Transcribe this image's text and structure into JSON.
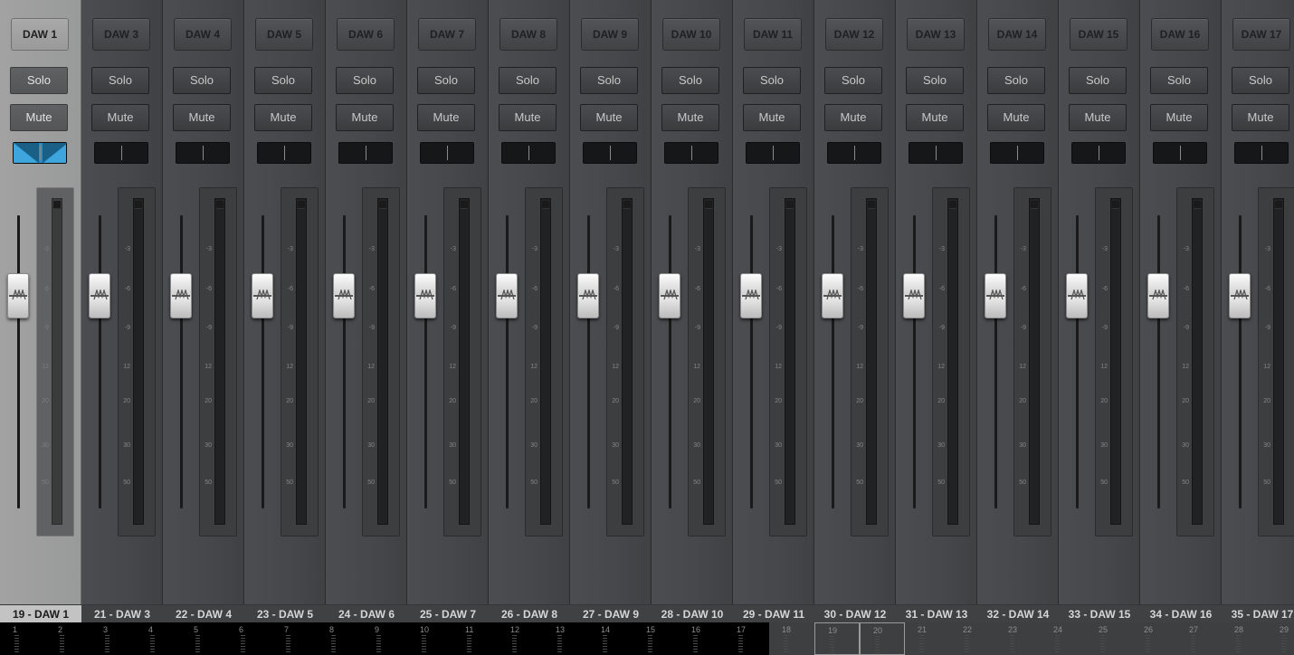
{
  "mixer": {
    "solo_label": "Solo",
    "mute_label": "Mute",
    "meter_ticks": [
      "-3",
      "-6",
      "-9",
      "12",
      "20",
      "30",
      "50"
    ],
    "channels": [
      {
        "name": "DAW 1",
        "label": "19 - DAW 1",
        "selected": true
      },
      {
        "name": "DAW 3",
        "label": "21 - DAW 3"
      },
      {
        "name": "DAW 4",
        "label": "22 - DAW 4"
      },
      {
        "name": "DAW 5",
        "label": "23 - DAW 5"
      },
      {
        "name": "DAW 6",
        "label": "24 - DAW 6"
      },
      {
        "name": "DAW 7",
        "label": "25 - DAW 7"
      },
      {
        "name": "DAW 8",
        "label": "26 - DAW 8"
      },
      {
        "name": "DAW 9",
        "label": "27 - DAW 9"
      },
      {
        "name": "DAW 10",
        "label": "28 - DAW 10"
      },
      {
        "name": "DAW 11",
        "label": "29 - DAW 11"
      },
      {
        "name": "DAW 12",
        "label": "30 - DAW 12"
      },
      {
        "name": "DAW 13",
        "label": "31 - DAW 13"
      },
      {
        "name": "DAW 14",
        "label": "32 - DAW 14"
      },
      {
        "name": "DAW 15",
        "label": "33 - DAW 15"
      },
      {
        "name": "DAW 16",
        "label": "34 - DAW 16"
      },
      {
        "name": "DAW 17",
        "label": "35 - DAW 17"
      }
    ]
  },
  "overview": {
    "cells": [
      "1",
      "2",
      "3",
      "4",
      "5",
      "6",
      "7",
      "8",
      "9",
      "10",
      "11",
      "12",
      "13",
      "14",
      "15",
      "16",
      "17",
      "18",
      "19",
      "20",
      "21",
      "22",
      "23",
      "24",
      "25",
      "26",
      "27",
      "28",
      "29"
    ],
    "first_in_view": "18",
    "active": [
      "19",
      "20"
    ]
  },
  "colors": {
    "accent": "#2c8ec6",
    "selected_strip": "#9c9c9c",
    "strip": "#46484b"
  }
}
